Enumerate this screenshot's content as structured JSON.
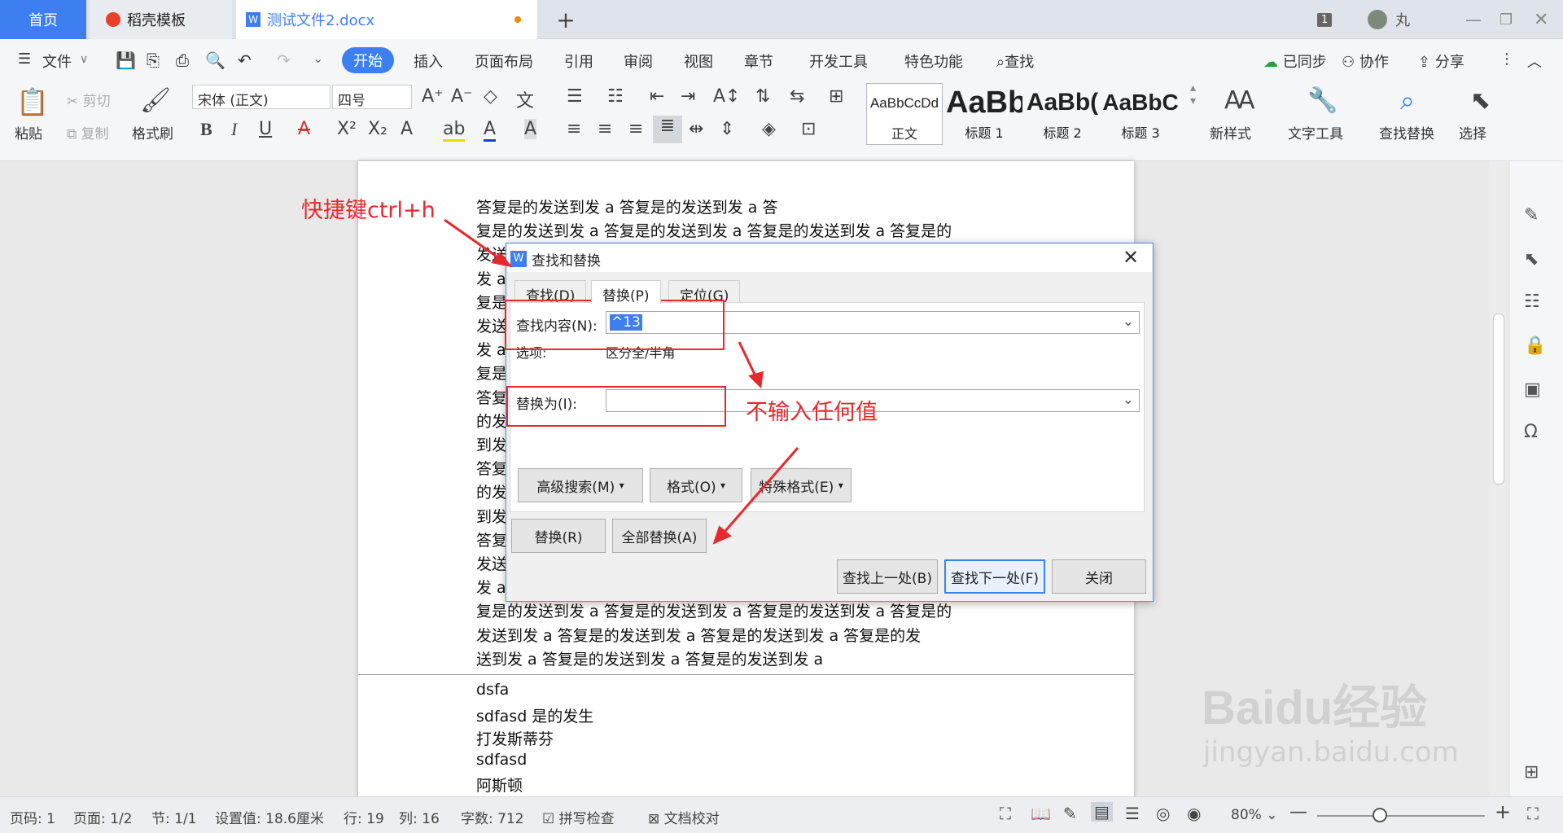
{
  "tabs": {
    "home": "首页",
    "template": "稻壳模板",
    "document": "测试文件2.docx",
    "user_badge": "1",
    "user_name": "丸"
  },
  "menu": {
    "file": "文件",
    "items": [
      "开始",
      "插入",
      "页面布局",
      "引用",
      "审阅",
      "视图",
      "章节",
      "开发工具",
      "特色功能"
    ],
    "search": "查找",
    "sync": "已同步",
    "collab": "协作",
    "share": "分享"
  },
  "ribbon": {
    "paste": "粘贴",
    "cut": "剪切",
    "copy": "复制",
    "format_painter": "格式刷",
    "font_name": "宋体 (正文)",
    "font_size": "四号",
    "styles": [
      {
        "preview": "AaBbCcDd",
        "label": "正文"
      },
      {
        "preview": "AaBb",
        "label": "标题 1"
      },
      {
        "preview": "AaBb(",
        "label": "标题 2"
      },
      {
        "preview": "AaBbC",
        "label": "标题 3"
      }
    ],
    "new_style": "新样式",
    "text_tools": "文字工具",
    "find_replace": "查找替换",
    "select": "选择"
  },
  "document": {
    "lines": [
      "答复是的发送到发 a 答复是的发送到发 a 答",
      "复是的发送到发 a 答复是的发送到发 a 答复是的发送到发 a 答复是的",
      "发送",
      "发 a",
      "复是",
      "发送",
      "发 a",
      "复是",
      "答复",
      "的发",
      "到发",
      "答复",
      "的发",
      "到发",
      "答复",
      "发送",
      "发 a",
      "复是的发送到发 a 答复是的发送到发 a 答复是的发送到发 a 答复是的",
      "发送到发 a 答复是的发送到发 a 答复是的发送到发 a 答复是的发",
      "送到发 a 答复是的发送到发 a 答复是的发送到发 a"
    ],
    "page2": [
      "dsfa",
      "sdfasd 是的发生",
      "打发斯蒂芬",
      "sdfasd",
      "阿斯顿"
    ]
  },
  "dialog": {
    "title": "查找和替换",
    "tabs": [
      "查找(D)",
      "替换(P)",
      "定位(G)"
    ],
    "find_label": "查找内容(N):",
    "find_value": "^13",
    "options_label": "选项:",
    "options_value": "区分全/半角",
    "replace_label": "替换为(I):",
    "replace_value": "",
    "advanced": "高级搜索(M)",
    "format": "格式(O)",
    "special": "特殊格式(E)",
    "replace_btn": "替换(R)",
    "replace_all": "全部替换(A)",
    "find_prev": "查找上一处(B)",
    "find_next": "查找下一处(F)",
    "close": "关闭"
  },
  "annotations": {
    "shortcut": "快捷键ctrl+h",
    "no_input": "不输入任何值"
  },
  "status": {
    "page_num": "页码: 1",
    "pages": "页面: 1/2",
    "section": "节: 1/1",
    "setting": "设置值: 18.6厘米",
    "row": "行: 19",
    "col": "列: 16",
    "words": "字数: 712",
    "spell": "拼写检查",
    "proof": "文档校对",
    "zoom": "80%"
  },
  "watermark": {
    "brand": "Baidu经验",
    "url": "jingyan.baidu.com"
  }
}
